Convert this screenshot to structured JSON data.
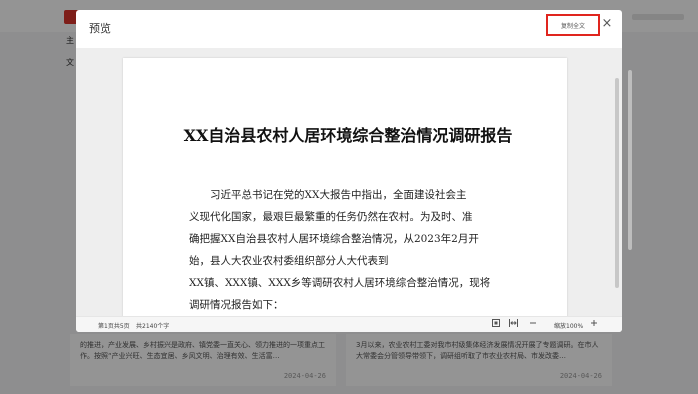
{
  "background": {
    "sidebar_labels": [
      "主",
      "文"
    ],
    "cards": [
      {
        "text": "的推进，产业发展、乡村振兴是政府、镇党委一直关心、领力推进的一项重点工作。按照“产业兴旺、生态宜居、乡风文明、治理有效、生活富…",
        "date": "2024-04-26"
      },
      {
        "text": "3月以来，农业农村工委对我市村级集体经济发展情况开展了专题调研。在市人大常委会分管领导带领下，调研组听取了市农业农村局、市发改委…",
        "date": "2024-04-26"
      }
    ]
  },
  "modal": {
    "title": "预览",
    "copy_button": "复制全文",
    "close_icon": "×"
  },
  "document": {
    "title": "XX自治县农村人居环境综合整治情况调研报告",
    "paragraph_lines": [
      "习近平总书记在党的XX大报告中指出，全面建设社会主",
      "义现代化国家，最艰巨最繁重的任务仍然在农村。为及时、准",
      "确把握XX自治县农村人居环境综合整治情况，从2023年2月开",
      "始，县人大农业农村委组织部分人大代表到",
      "XX镇、XXX镇、XXX乡等调研农村人居环境综合整治情况，现将",
      "调研情况报告如下："
    ]
  },
  "status_bar": {
    "page_info": "第1页共5页",
    "word_count": "共2140个字",
    "zoom_label": "缩放100%",
    "icons": [
      "fit-page-icon",
      "fit-width-icon",
      "zoom-out-icon",
      "zoom-in-icon"
    ]
  }
}
